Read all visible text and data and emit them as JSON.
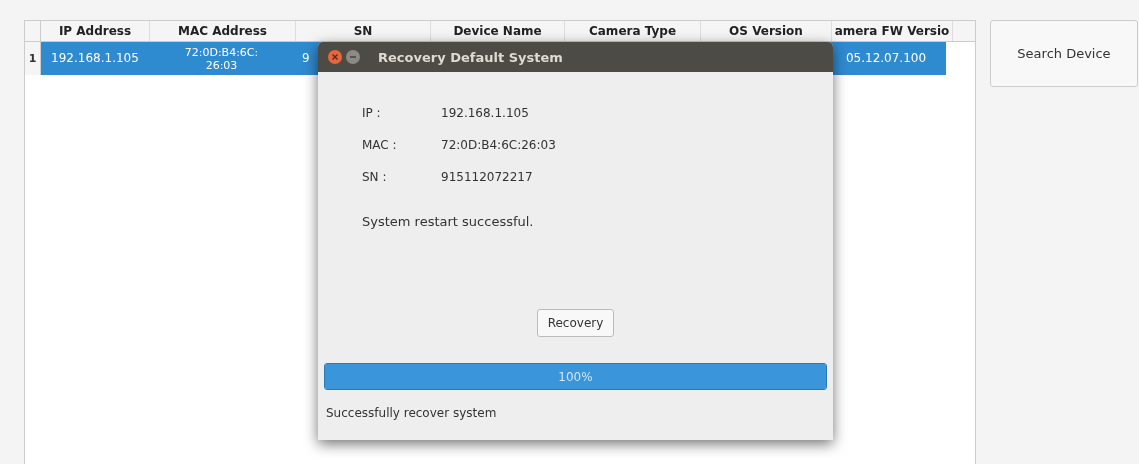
{
  "table": {
    "columns": [
      "IP Address",
      "MAC Address",
      "SN",
      "Device Name",
      "Camera Type",
      "OS Version",
      "amera FW Versio"
    ],
    "rows": [
      {
        "index": "1",
        "selected": true,
        "ip": "192.168.1.105",
        "mac": "72:0D:B4:6C:\n26:03",
        "sn": "9",
        "fw": "05.12.07.100"
      }
    ]
  },
  "search_button": "Search Device",
  "dialog": {
    "title": "Recovery Default System",
    "fields": [
      {
        "label": "IP :",
        "value": "192.168.1.105"
      },
      {
        "label": "MAC :",
        "value": "72:0D:B4:6C:26:03"
      },
      {
        "label": "SN :",
        "value": "915112072217"
      }
    ],
    "message": "System restart successful.",
    "button": "Recovery",
    "progress": {
      "level": 1,
      "text": "100%"
    },
    "status": "Successfully recover system"
  }
}
